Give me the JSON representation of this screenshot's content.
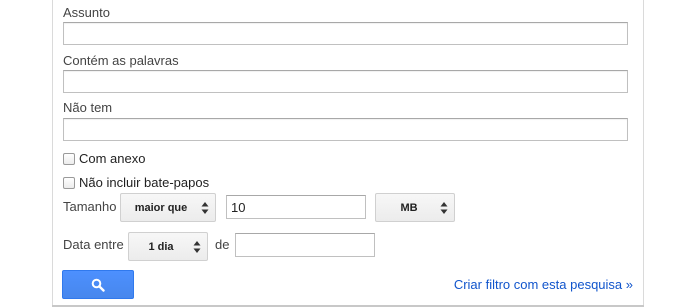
{
  "form": {
    "subject": {
      "label": "Assunto",
      "value": ""
    },
    "has_words": {
      "label": "Contém as palavras",
      "value": ""
    },
    "doesnt_have": {
      "label": "Não tem",
      "value": ""
    },
    "has_attachment": {
      "label": "Com anexo",
      "checked": false
    },
    "exclude_chats": {
      "label": "Não incluir bate-papos",
      "checked": false
    },
    "size": {
      "label": "Tamanho",
      "operator": "maior que",
      "value": "10",
      "unit": "MB"
    },
    "date_within": {
      "label": "Data entre",
      "range": "1 dia",
      "of_label": "de",
      "date_value": ""
    },
    "search_button_icon": "search-icon",
    "create_filter_link": "Criar filtro com esta pesquisa »"
  },
  "colors": {
    "accent": "#4d90fe",
    "link": "#1155cc"
  }
}
